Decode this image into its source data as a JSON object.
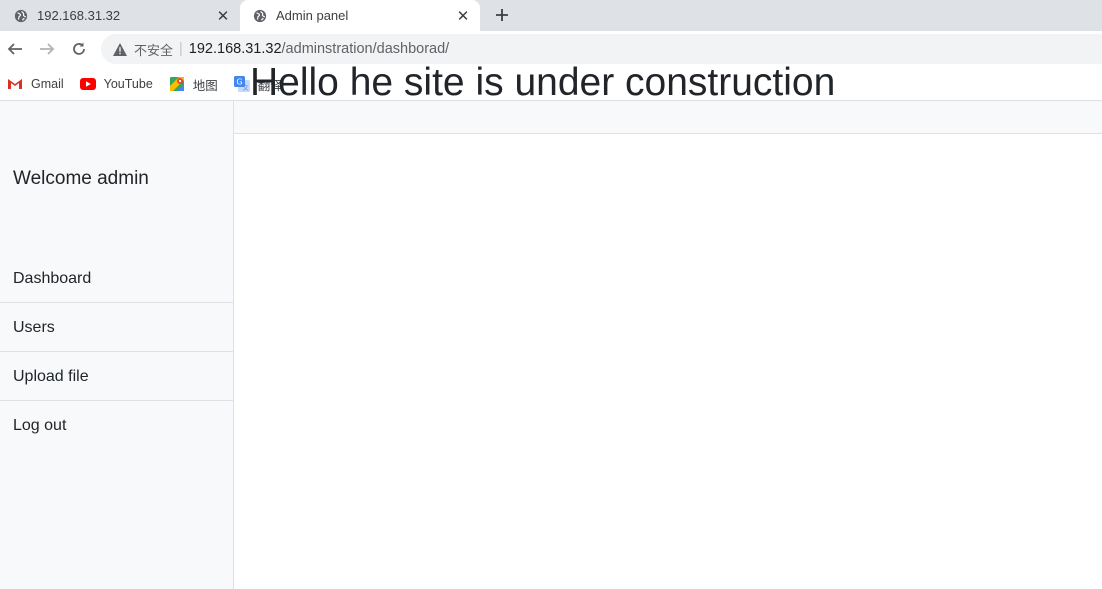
{
  "browser": {
    "tabs": [
      {
        "title": "192.168.31.32",
        "favicon": "globe-icon",
        "active": false
      },
      {
        "title": "Admin panel",
        "favicon": "globe-icon",
        "active": true
      }
    ],
    "address": {
      "security_label": "不安全",
      "host": "192.168.31.32",
      "path": "/adminstration/dashborad/"
    },
    "bookmarks": [
      {
        "label": "Gmail",
        "icon": "gmail-icon"
      },
      {
        "label": "YouTube",
        "icon": "youtube-icon"
      },
      {
        "label": "地图",
        "icon": "maps-icon"
      },
      {
        "label": "翻译",
        "icon": "translate-icon"
      }
    ]
  },
  "sidebar": {
    "welcome": "Welcome admin",
    "items": [
      {
        "label": "Dashboard"
      },
      {
        "label": "Users"
      },
      {
        "label": "Upload file"
      },
      {
        "label": "Log out"
      }
    ]
  },
  "main": {
    "heading": "Hello he site is under construction"
  }
}
